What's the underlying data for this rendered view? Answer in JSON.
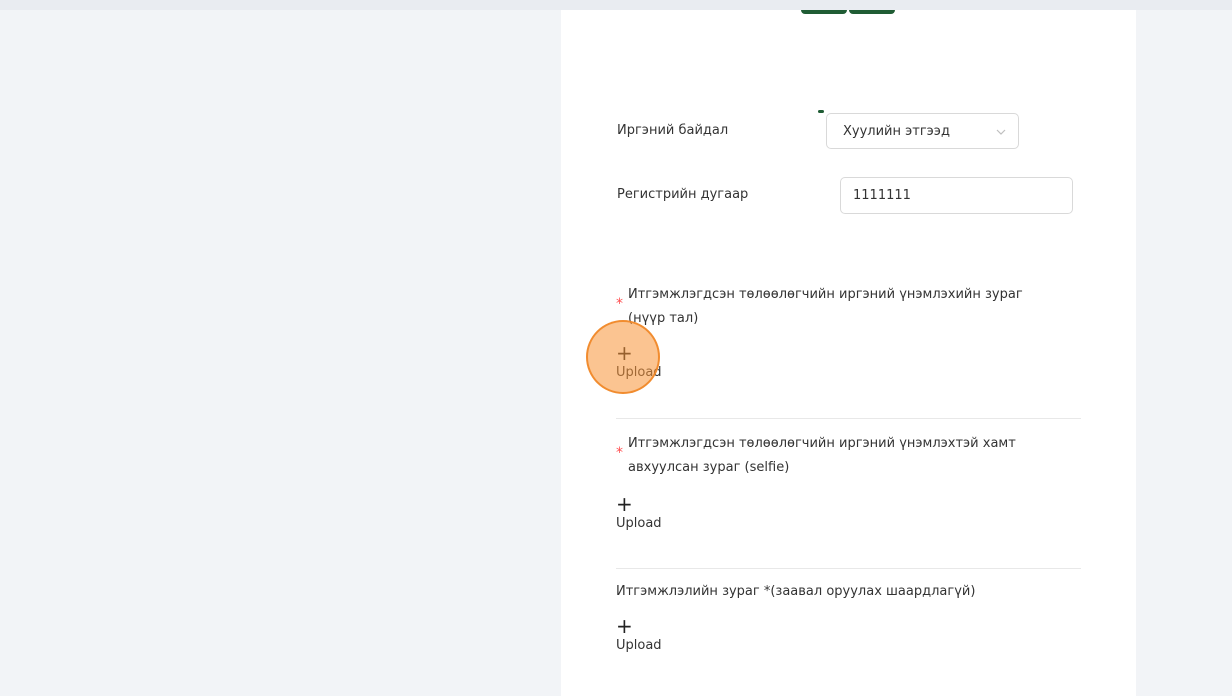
{
  "form": {
    "citizen_status": {
      "label": "Иргэний байдал",
      "selected": "Хуулийн этгээд"
    },
    "register_number": {
      "label": "Регистрийн дугаар",
      "value": "1111111"
    },
    "uploads": [
      {
        "required_mark": "*",
        "title_line1": "Итгэмжлэгдсэн төлөөлөгчийн иргэний үнэмлэхийн зураг",
        "title_line2": "(нүүр тал)",
        "plus": "+",
        "button_label": "Upload"
      },
      {
        "required_mark": "*",
        "title_line1": "Итгэмжлэгдсэн төлөөлөгчийн иргэний үнэмлэхтэй хамт",
        "title_line2": "авхуулсан зураг (selfie)",
        "plus": "+",
        "button_label": "Upload"
      },
      {
        "title_line1": "Итгэмжлэлийн зураг *(заавал оруулах шаардлагүй)",
        "plus": "+",
        "button_label": "Upload"
      }
    ]
  },
  "colors": {
    "background": "#f2f4f7",
    "card": "#ffffff",
    "accent_green": "#1f5c34",
    "required_red": "#ff4d4f",
    "click_indicator": "#f79437"
  }
}
